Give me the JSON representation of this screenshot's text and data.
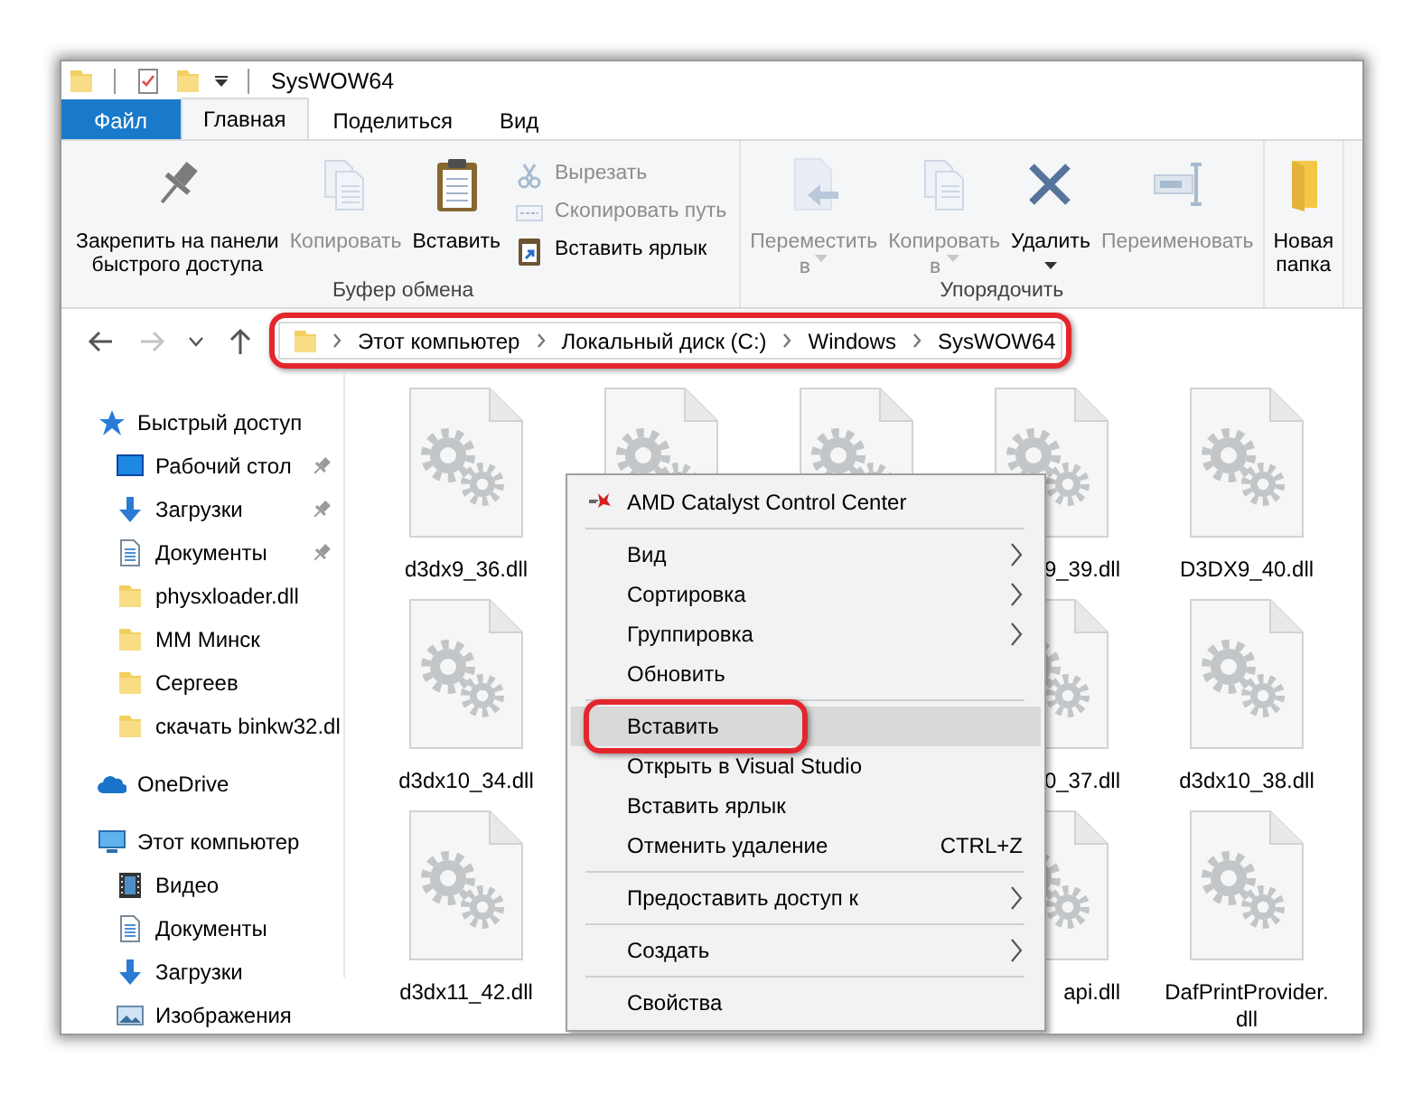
{
  "title_bar": {
    "title": "SysWOW64"
  },
  "tabs": [
    {
      "label": "Файл",
      "kind": "file",
      "selected": false
    },
    {
      "label": "Главная",
      "kind": "tab",
      "selected": true
    },
    {
      "label": "Поделиться",
      "kind": "tab",
      "selected": false
    },
    {
      "label": "Вид",
      "kind": "tab",
      "selected": false
    }
  ],
  "ribbon": {
    "groups": [
      {
        "label": "Буфер обмена",
        "items": [
          {
            "kind": "large",
            "lines": [
              "Закрепить на панели",
              "быстрого доступа"
            ],
            "dropdown": false,
            "disabled": false
          },
          {
            "kind": "large",
            "lines": [
              "Копировать"
            ],
            "dropdown": false,
            "disabled": true
          },
          {
            "kind": "large",
            "lines": [
              "Вставить"
            ],
            "dropdown": false,
            "disabled": false
          },
          {
            "kind": "small",
            "label": "Вырезать",
            "disabled": true
          },
          {
            "kind": "small",
            "label": "Скопировать путь",
            "disabled": true
          },
          {
            "kind": "small",
            "label": "Вставить ярлык",
            "disabled": false
          }
        ]
      },
      {
        "label": "Упорядочить",
        "items": [
          {
            "kind": "large",
            "lines": [
              "Переместить",
              "в"
            ],
            "dropdown": true,
            "disabled": true
          },
          {
            "kind": "large",
            "lines": [
              "Копировать",
              "в"
            ],
            "dropdown": true,
            "disabled": true
          },
          {
            "kind": "large",
            "lines": [
              "Удалить"
            ],
            "dropdown": true,
            "disabled": false
          },
          {
            "kind": "large",
            "lines": [
              "Переименовать"
            ],
            "dropdown": false,
            "disabled": true
          }
        ]
      },
      {
        "items": [
          {
            "kind": "large",
            "lines": [
              "Новая",
              "папка"
            ],
            "dropdown": false,
            "disabled": false
          }
        ]
      }
    ]
  },
  "navigation": [
    {
      "kind": "back",
      "disabled": false
    },
    {
      "kind": "forward",
      "disabled": true
    },
    {
      "kind": "recent",
      "disabled": false
    },
    {
      "kind": "up",
      "disabled": false
    }
  ],
  "address_bar": {
    "annotated": true,
    "crumbs": [
      "Этот компьютер",
      "Локальный диск (C:)",
      "Windows",
      "SysWOW64"
    ]
  },
  "sidebar": {
    "items": [
      {
        "kind": "quick_access",
        "label": "Быстрый доступ",
        "pinned": false,
        "children": [
          {
            "kind": "desktop",
            "label": "Рабочий стол",
            "pinned": true
          },
          {
            "kind": "downloads",
            "label": "Загрузки",
            "pinned": true
          },
          {
            "kind": "documents",
            "label": "Документы",
            "pinned": true
          },
          {
            "kind": "folder",
            "label": "physxloader.dll",
            "pinned": false
          },
          {
            "kind": "folder",
            "label": "ММ Минск",
            "pinned": false
          },
          {
            "kind": "folder",
            "label": "Сергеев",
            "pinned": false
          },
          {
            "kind": "folder",
            "label": "скачать binkw32.dl",
            "pinned": false
          }
        ]
      },
      {
        "kind": "onedrive",
        "label": "OneDrive",
        "pinned": false
      },
      {
        "kind": "computer",
        "label": "Этот компьютер",
        "pinned": false,
        "children": [
          {
            "kind": "videos",
            "label": "Видео",
            "pinned": false
          },
          {
            "kind": "documents",
            "label": "Документы",
            "pinned": false
          },
          {
            "kind": "downloads",
            "label": "Загрузки",
            "pinned": false
          },
          {
            "kind": "pictures",
            "label": "Изображения",
            "pinned": false
          }
        ]
      }
    ]
  },
  "files": [
    {
      "kind": "file",
      "label": "d3dx9_36.dll"
    },
    {
      "kind": "covered"
    },
    {
      "kind": "covered"
    },
    {
      "kind": "cut",
      "label": "9_39.dll"
    },
    {
      "kind": "file",
      "label": "D3DX9_40.dll"
    },
    {
      "kind": "file",
      "label": "d3dx10_34.dll"
    },
    {
      "kind": "cut",
      "label": "0_37.dll"
    },
    {
      "kind": "file",
      "label": "d3dx10_38.dll"
    },
    {
      "kind": "file",
      "label": "d3dx11_42.dll"
    },
    {
      "kind": "cut",
      "label": "api.dll"
    },
    {
      "kind": "file",
      "label": "DafPrintProvider.dll"
    }
  ],
  "context_menu": {
    "items": [
      {
        "kind": "app",
        "label": "AMD Catalyst Control Center",
        "selected": false
      },
      {
        "kind": "separator"
      },
      {
        "kind": "command",
        "label": "Вид",
        "submenu": true,
        "selected": false
      },
      {
        "kind": "command",
        "label": "Сортировка",
        "submenu": true,
        "selected": false
      },
      {
        "kind": "command",
        "label": "Группировка",
        "submenu": true,
        "selected": false
      },
      {
        "kind": "command",
        "label": "Обновить",
        "selected": false
      },
      {
        "kind": "separator"
      },
      {
        "kind": "command",
        "label": "Вставить",
        "selected": true,
        "annotated": true
      },
      {
        "kind": "command",
        "label": "Открыть в Visual Studio",
        "selected": false
      },
      {
        "kind": "command",
        "label": "Вставить ярлык",
        "selected": false
      },
      {
        "kind": "command",
        "label": "Отменить удаление",
        "shortcut": "CTRL+Z",
        "selected": false
      },
      {
        "kind": "separator"
      },
      {
        "kind": "command",
        "label": "Предоставить доступ к",
        "submenu": true,
        "selected": false
      },
      {
        "kind": "separator"
      },
      {
        "kind": "command",
        "label": "Создать",
        "submenu": true,
        "selected": false
      },
      {
        "kind": "separator"
      },
      {
        "kind": "command",
        "label": "Свойства",
        "selected": false
      }
    ]
  }
}
